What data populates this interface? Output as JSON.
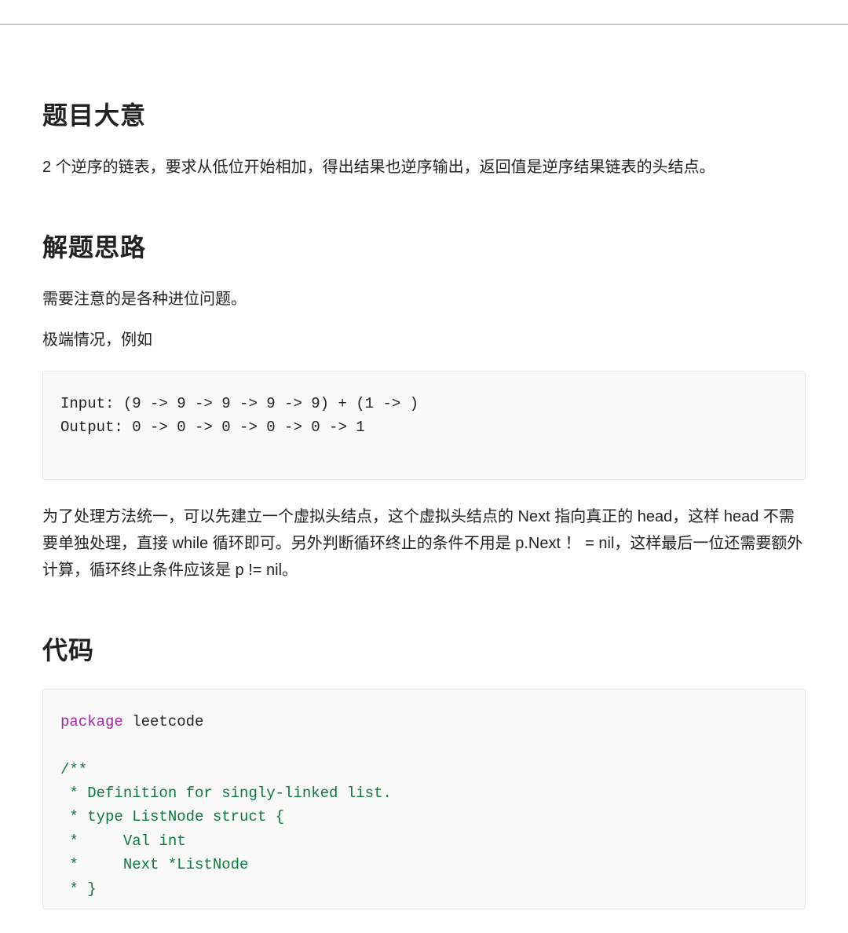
{
  "sections": {
    "meaning": {
      "heading": "题目大意",
      "para1": "2 个逆序的链表，要求从低位开始相加，得出结果也逆序输出，返回值是逆序结果链表的头结点。"
    },
    "approach": {
      "heading": "解题思路",
      "para1": "需要注意的是各种进位问题。",
      "para2": "极端情况，例如",
      "example_code": "Input: (9 -> 9 -> 9 -> 9 -> 9) + (1 -> )\nOutput: 0 -> 0 -> 0 -> 0 -> 0 -> 1",
      "para3": "为了处理方法统一，可以先建立一个虚拟头结点，这个虚拟头结点的 Next 指向真正的 head，这样 head 不需要单独处理，直接 while 循环即可。另外判断循环终止的条件不用是 p.Next ！ = nil，这样最后一位还需要额外计算，循环终止条件应该是 p != nil。"
    },
    "code": {
      "heading": "代码",
      "tokens": {
        "kw_package": "package",
        "pkg_name": " leetcode",
        "comment_block": "/**\n * Definition for singly-linked list.\n * type ListNode struct {\n *     Val int\n *     Next *ListNode\n * }"
      }
    }
  }
}
